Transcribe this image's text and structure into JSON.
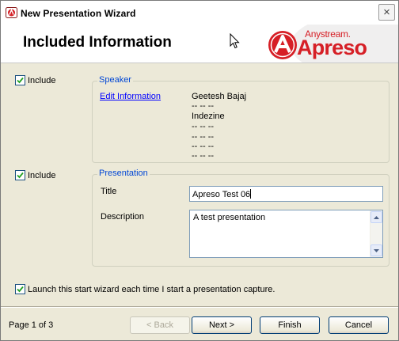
{
  "window": {
    "title": "New Presentation Wizard",
    "close_glyph": "×"
  },
  "header": {
    "title": "Included Information",
    "logo_top": "Anystream.",
    "logo_main": "Apreso",
    "logo_color": "#d61f26"
  },
  "speaker_section": {
    "include_label": "Include",
    "include_checked": true,
    "legend": "Speaker",
    "edit_link": "Edit Information",
    "lines": [
      "Geetesh Bajaj",
      "-- -- --",
      "Indezine",
      "-- -- --",
      "-- -- --",
      "-- -- --",
      "-- -- --"
    ]
  },
  "presentation_section": {
    "include_label": "Include",
    "include_checked": true,
    "legend": "Presentation",
    "title_label": "Title",
    "title_value": "Apreso Test 06",
    "description_label": "Description",
    "description_value": "A test presentation"
  },
  "launch_option": {
    "label": "Launch this start wizard each time I start a presentation capture.",
    "checked": true
  },
  "footer": {
    "page_indicator": "Page 1 of 3",
    "back_label": "< Back",
    "next_label": "Next >",
    "finish_label": "Finish",
    "cancel_label": "Cancel"
  },
  "colors": {
    "legend_text": "#0046d5",
    "link_text": "#0000ff",
    "dialog_bg": "#ece9d8"
  }
}
